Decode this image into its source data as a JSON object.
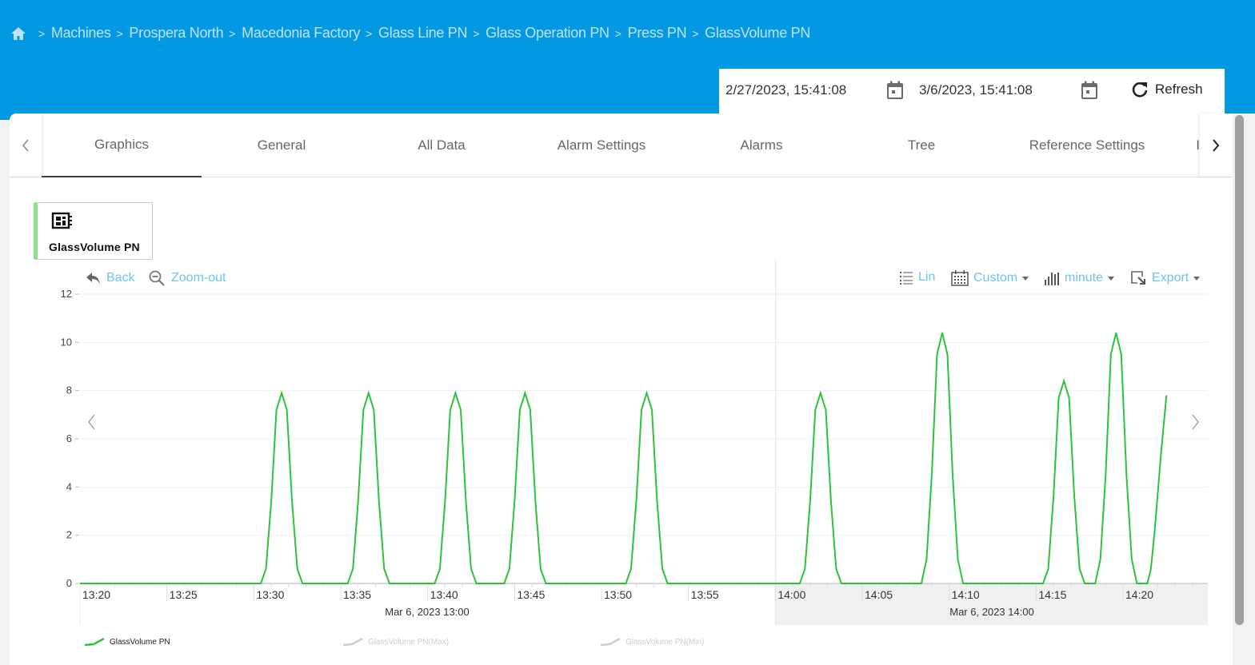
{
  "breadcrumb": {
    "home_icon": "home-icon",
    "items": [
      "Machines",
      "Prospera North",
      "Macedonia Factory",
      "Glass Line PN",
      "Glass Operation PN",
      "Press PN",
      "GlassVolume PN"
    ]
  },
  "date_range": {
    "start": "2/27/2023, 15:41:08",
    "end": "3/6/2023, 15:41:08",
    "refresh_label": "Refresh"
  },
  "tabs": [
    {
      "label": "Graphics",
      "active": true
    },
    {
      "label": "General"
    },
    {
      "label": "All Data"
    },
    {
      "label": "Alarm Settings"
    },
    {
      "label": "Alarms"
    },
    {
      "label": "Tree"
    },
    {
      "label": "Reference Settings"
    },
    {
      "label": "I"
    }
  ],
  "sensor_card": {
    "label": "GlassVolume PN",
    "accent_color": "#8ee08a"
  },
  "toolbar": {
    "back_label": "Back",
    "zoom_out_label": "Zoom-out",
    "scale_label": "Lin",
    "range_label": "Custom",
    "interval_label": "minute",
    "export_label": "Export"
  },
  "colors": {
    "header": "#0399e2",
    "series": "#2ec23a",
    "link": "#6ec3ee"
  },
  "chart_data": {
    "type": "line",
    "title": "",
    "xlabel": "",
    "ylabel": "",
    "ylim": [
      0,
      12
    ],
    "yticks": [
      "0",
      "2",
      "4",
      "6",
      "8",
      "10",
      "12"
    ],
    "xlim_minutes_after_13_00": [
      19.9,
      87.3
    ],
    "xticks": [
      {
        "label": "13:20",
        "m": 20
      },
      {
        "label": "13:25",
        "m": 25
      },
      {
        "label": "13:30",
        "m": 30
      },
      {
        "label": "13:35",
        "m": 35
      },
      {
        "label": "13:40",
        "m": 40
      },
      {
        "label": "13:45",
        "m": 45
      },
      {
        "label": "13:50",
        "m": 50
      },
      {
        "label": "13:55",
        "m": 55
      },
      {
        "label": "14:00",
        "m": 60
      },
      {
        "label": "14:05",
        "m": 65
      },
      {
        "label": "14:10",
        "m": 70
      },
      {
        "label": "14:15",
        "m": 75
      },
      {
        "label": "14:20",
        "m": 80
      }
    ],
    "group_labels": [
      {
        "label": "Mar 6, 2023 13:00",
        "from": 19.9,
        "to": 60
      },
      {
        "label": "Mar 6, 2023 14:00",
        "from": 60,
        "to": 87.3
      }
    ],
    "grid": true,
    "legend_position": "bottom-left",
    "series": [
      {
        "name": "GlassVolume PN",
        "color": "#2ec23a",
        "enabled": true,
        "points": [
          [
            20,
            0
          ],
          [
            30.4,
            0
          ],
          [
            30.7,
            0.6
          ],
          [
            31.0,
            3.4
          ],
          [
            31.3,
            7.2
          ],
          [
            31.6,
            7.9
          ],
          [
            31.9,
            7.2
          ],
          [
            32.2,
            3.4
          ],
          [
            32.5,
            0.6
          ],
          [
            32.8,
            0
          ],
          [
            35.4,
            0
          ],
          [
            35.7,
            0.6
          ],
          [
            36.0,
            3.4
          ],
          [
            36.3,
            7.2
          ],
          [
            36.6,
            7.9
          ],
          [
            36.9,
            7.2
          ],
          [
            37.2,
            3.4
          ],
          [
            37.5,
            0.6
          ],
          [
            37.8,
            0
          ],
          [
            40.4,
            0
          ],
          [
            40.7,
            0.6
          ],
          [
            41.0,
            3.4
          ],
          [
            41.3,
            7.2
          ],
          [
            41.6,
            7.9
          ],
          [
            41.9,
            7.2
          ],
          [
            42.2,
            3.4
          ],
          [
            42.5,
            0.6
          ],
          [
            42.8,
            0
          ],
          [
            44.4,
            0
          ],
          [
            44.7,
            0.6
          ],
          [
            45.0,
            3.4
          ],
          [
            45.3,
            7.2
          ],
          [
            45.6,
            7.9
          ],
          [
            45.9,
            7.2
          ],
          [
            46.2,
            3.4
          ],
          [
            46.5,
            0.6
          ],
          [
            46.8,
            0
          ],
          [
            51.4,
            0
          ],
          [
            51.7,
            0.6
          ],
          [
            52.0,
            3.4
          ],
          [
            52.3,
            7.2
          ],
          [
            52.6,
            7.9
          ],
          [
            52.9,
            7.2
          ],
          [
            53.2,
            3.4
          ],
          [
            53.5,
            0.6
          ],
          [
            53.8,
            0
          ],
          [
            61.4,
            0
          ],
          [
            61.7,
            0.6
          ],
          [
            62.0,
            3.4
          ],
          [
            62.3,
            7.2
          ],
          [
            62.6,
            7.9
          ],
          [
            62.9,
            7.2
          ],
          [
            63.2,
            3.4
          ],
          [
            63.5,
            0.6
          ],
          [
            63.8,
            0
          ],
          [
            68.4,
            0
          ],
          [
            68.7,
            1.0
          ],
          [
            69.0,
            4.5
          ],
          [
            69.3,
            9.5
          ],
          [
            69.6,
            10.4
          ],
          [
            69.9,
            9.5
          ],
          [
            70.2,
            4.5
          ],
          [
            70.5,
            1.0
          ],
          [
            70.8,
            0
          ],
          [
            75.4,
            0
          ],
          [
            75.7,
            0.6
          ],
          [
            76.0,
            3.6
          ],
          [
            76.3,
            7.7
          ],
          [
            76.6,
            8.4
          ],
          [
            76.9,
            7.7
          ],
          [
            77.2,
            3.6
          ],
          [
            77.5,
            0.6
          ],
          [
            77.8,
            0
          ],
          [
            78.4,
            0
          ],
          [
            78.7,
            1.0
          ],
          [
            79.0,
            4.5
          ],
          [
            79.3,
            9.5
          ],
          [
            79.6,
            10.4
          ],
          [
            79.9,
            9.5
          ],
          [
            80.2,
            4.5
          ],
          [
            80.5,
            1.0
          ],
          [
            80.8,
            0
          ],
          [
            81.4,
            0
          ],
          [
            81.6,
            0.6
          ],
          [
            81.8,
            2.0
          ],
          [
            82.2,
            5.5
          ],
          [
            82.5,
            7.8
          ]
        ]
      },
      {
        "name": "GlassVolume PN(Max)",
        "color": "#cccccc",
        "enabled": false,
        "points": []
      },
      {
        "name": "GlassVolume PN(Min)",
        "color": "#cccccc",
        "enabled": false,
        "points": []
      }
    ]
  }
}
